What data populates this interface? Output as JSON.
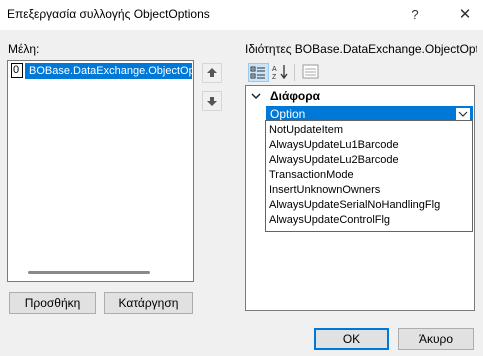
{
  "window": {
    "title": "Επεξεργασία συλλογής ObjectOptions",
    "help_label": "?",
    "close_label": "✕"
  },
  "members": {
    "label": "Μέλη:",
    "items": [
      {
        "index": "0",
        "text": "BOBase.DataExchange.ObjectOptions"
      }
    ],
    "add_button": "Προσθήκη",
    "remove_button": "Κατάργηση"
  },
  "properties": {
    "label": "Ιδιότητες BOBase.DataExchange.ObjectOpt...",
    "category": "Διάφορα",
    "property_name": "Option",
    "dropdown_options": [
      "NotUpdateItem",
      "AlwaysUpdateLu1Barcode",
      "AlwaysUpdateLu2Barcode",
      "TransactionMode",
      "InsertUnknownOwners",
      "AlwaysUpdateSerialNoHandlingFlg",
      "AlwaysUpdateControlFlg"
    ]
  },
  "footer": {
    "ok_button": "OK",
    "cancel_button": "Άκυρο"
  },
  "colors": {
    "accent": "#0078d7",
    "background": "#f0f0f0"
  },
  "icons": [
    "move-up-icon",
    "move-down-icon",
    "categorized-icon",
    "alphabetical-icon",
    "property-pages-icon",
    "collapse-icon",
    "chevron-down-icon"
  ]
}
